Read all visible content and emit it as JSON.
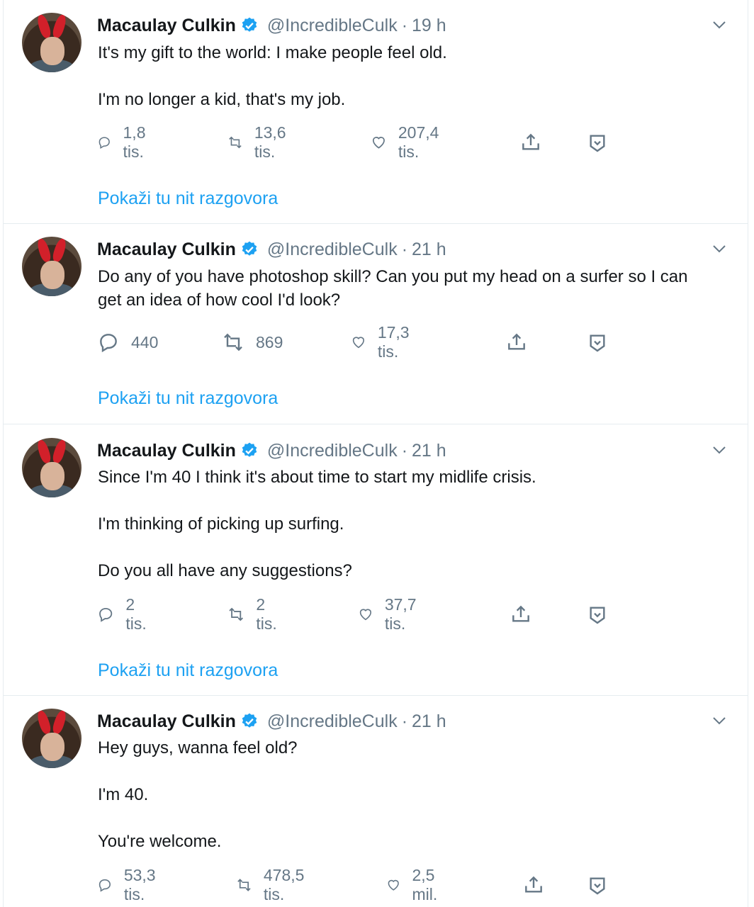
{
  "author": {
    "name": "Macaulay Culkin",
    "handle": "@IncredibleCulk"
  },
  "colors": {
    "link": "#1da1f2",
    "muted": "#657786",
    "text": "#14171a",
    "verified": "#1da1f2"
  },
  "tweets": [
    {
      "time": "19 h",
      "paragraphs": [
        "It's my gift to the world: I make people feel old.",
        "I'm no longer a kid, that's my job."
      ],
      "replies": "1,8 tis.",
      "retweets": "13,6 tis.",
      "likes": "207,4 tis.",
      "thread_link": "Pokaži tu nit razgovora"
    },
    {
      "time": "21 h",
      "paragraphs": [
        "Do any of you have photoshop skill? Can you put my head on a surfer so I can get an idea of how cool I'd look?"
      ],
      "replies": "440",
      "retweets": "869",
      "likes": "17,3 tis.",
      "thread_link": "Pokaži tu nit razgovora"
    },
    {
      "time": "21 h",
      "paragraphs": [
        "Since I'm 40 I think it's about time to start my midlife crisis.",
        "I'm thinking of picking up surfing.",
        "Do you all have any suggestions?"
      ],
      "replies": "2 tis.",
      "retweets": "2 tis.",
      "likes": "37,7 tis.",
      "thread_link": "Pokaži tu nit razgovora"
    },
    {
      "time": "21 h",
      "paragraphs": [
        "Hey guys, wanna feel old?",
        "I'm 40.",
        "You're welcome."
      ],
      "replies": "53,3 tis.",
      "retweets": "478,5 tis.",
      "likes": "2,5 mil.",
      "thread_link": ""
    }
  ],
  "icons": {
    "reply": "reply-icon",
    "retweet": "retweet-icon",
    "like": "heart-icon",
    "share": "share-icon",
    "more": "chevron-down-icon",
    "bookmark": "bookmark-icon",
    "verified": "verified-badge-icon"
  }
}
